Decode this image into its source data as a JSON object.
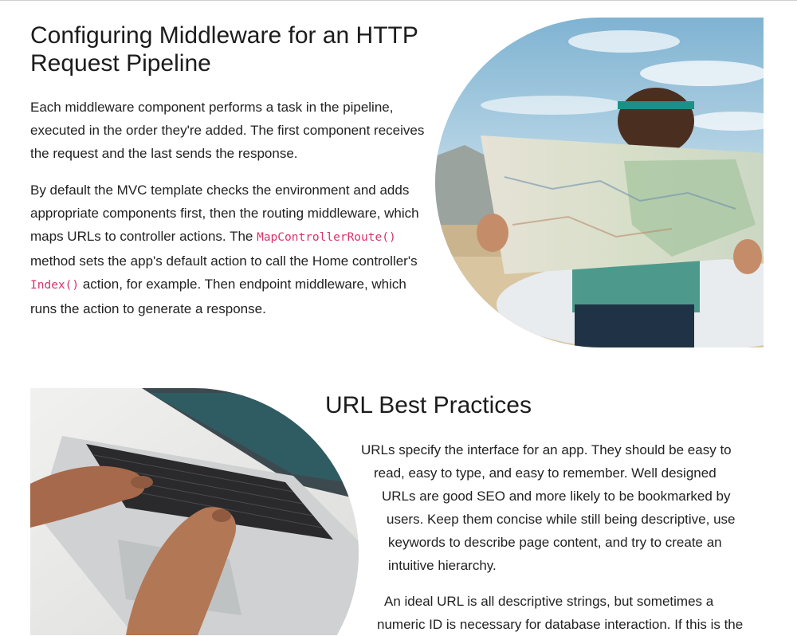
{
  "section1": {
    "title": "Configuring Middleware for an HTTP Request Pipeline",
    "para1": "Each middleware component performs a task in the pipeline, executed in the order they're added. The first component receives the request and the last sends the response.",
    "para2_part1": "By default the MVC template checks the environment and adds appropriate components first, then the routing middleware, which maps URLs to controller actions. The ",
    "para2_code1": "MapControllerRoute()",
    "para2_part2": " method sets the app's default action to call the Home controller's ",
    "para2_code2": "Index()",
    "para2_part3": " action, for example. Then endpoint middleware, which runs the action to generate a response.",
    "image_icon": "woman-reading-map-photo"
  },
  "section2": {
    "title": "URL Best Practices",
    "para1_lines": [
      "URLs specify the interface for an app. They should be easy to",
      "read, easy to type, and easy to remember. Well designed",
      "URLs are good SEO and more likely to be bookmarked by",
      "users. Keep them concise while still being descriptive, use",
      "keywords to describe page content, and try to create an",
      "intuitive hierarchy."
    ],
    "para2_lines": [
      "An ideal URL is all descriptive strings, but sometimes a",
      "numeric ID is necessary for database interaction. If this is the"
    ],
    "image_icon": "hands-typing-laptop-photo"
  },
  "colors": {
    "code": "#d6336c",
    "text": "#222222",
    "sky": "#9cc3d9"
  }
}
